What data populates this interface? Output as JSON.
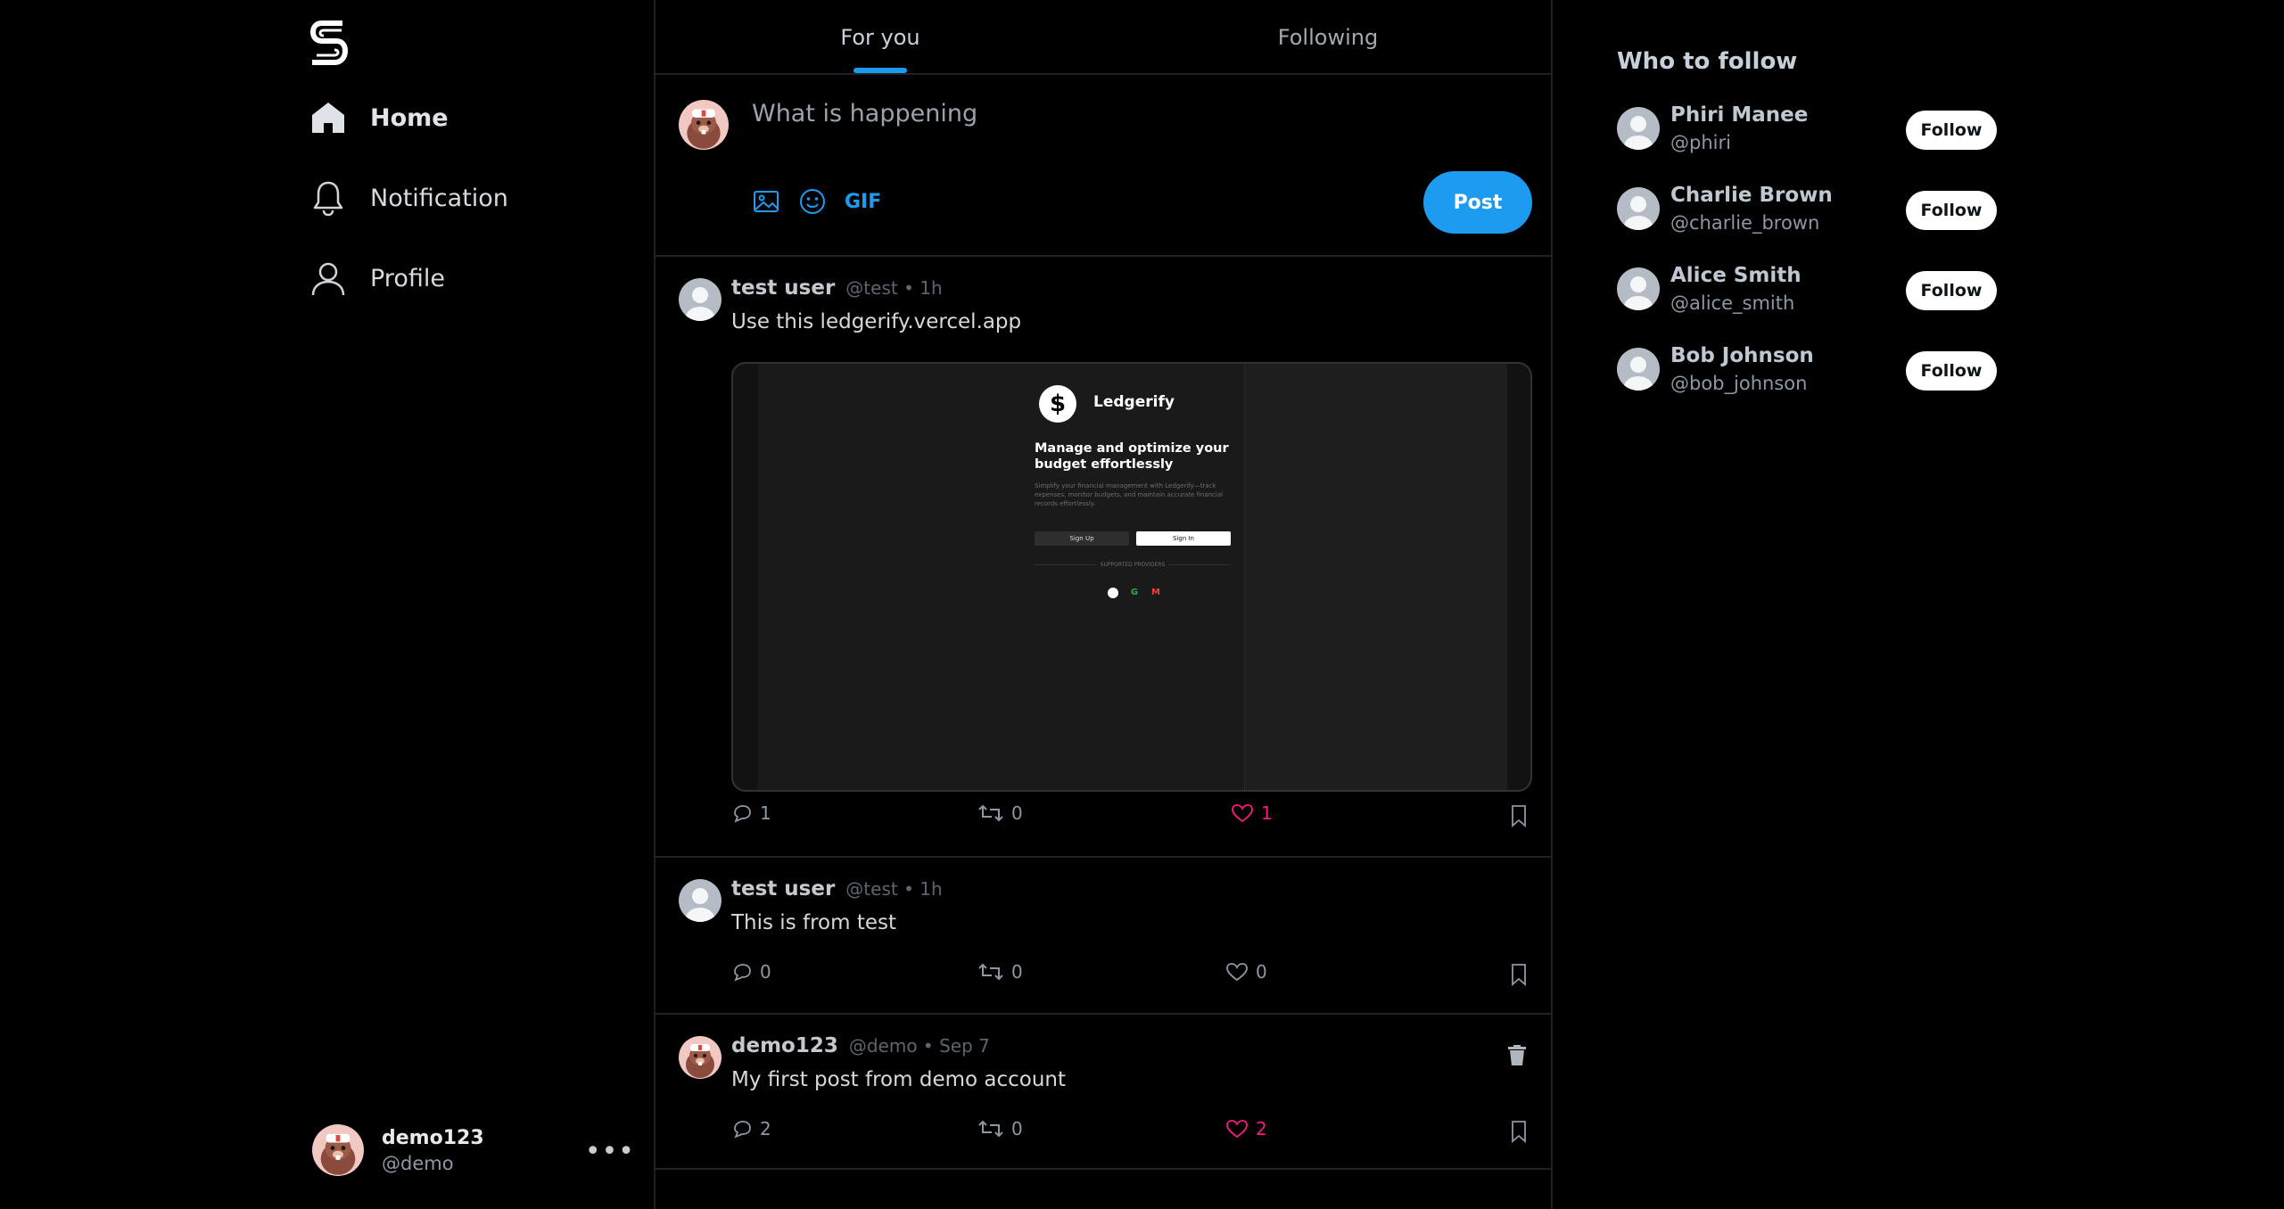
{
  "nav": {
    "items": [
      {
        "label": "Home",
        "icon": "home-icon"
      },
      {
        "label": "Notification",
        "icon": "bell-icon"
      },
      {
        "label": "Profile",
        "icon": "user-icon"
      }
    ]
  },
  "account": {
    "name": "demo123",
    "handle": "@demo",
    "more": "•••"
  },
  "tabs": [
    {
      "label": "For you"
    },
    {
      "label": "Following"
    }
  ],
  "composer": {
    "placeholder": "What is happening",
    "gif_label": "GIF",
    "post_label": "Post"
  },
  "posts": [
    {
      "user": "test user",
      "meta": "@test • 1h",
      "text": "Use this ledgerify.vercel.app",
      "replies": "1",
      "reposts": "0",
      "likes": "1",
      "liked": true,
      "preview": {
        "brand": "Ledgerify",
        "brand_glyph": "$",
        "headline": "Manage and optimize your budget effortlessly",
        "subtitle": "Simplify your financial management with Ledgerify—track expenses, monitor budgets, and maintain accurate financial records effortlessly.",
        "signup": "Sign Up",
        "signin": "Sign In",
        "providers_label": "SUPPORTED PROVIDERS"
      }
    },
    {
      "user": "test user",
      "meta": "@test • 1h",
      "text": "This is from test",
      "replies": "0",
      "reposts": "0",
      "likes": "0",
      "liked": false
    },
    {
      "user": "demo123",
      "meta": "@demo • Sep 7",
      "text": "My first post from demo account",
      "replies": "2",
      "reposts": "0",
      "likes": "2",
      "liked": true
    }
  ],
  "who_to_follow": {
    "title": "Who to follow",
    "button_label": "Follow",
    "users": [
      {
        "name": "Phiri Manee",
        "handle": "@phiri"
      },
      {
        "name": "Charlie Brown",
        "handle": "@charlie_brown"
      },
      {
        "name": "Alice Smith",
        "handle": "@alice_smith"
      },
      {
        "name": "Bob Johnson",
        "handle": "@bob_johnson"
      }
    ]
  },
  "colors": {
    "accent": "#1d9bf0",
    "like": "#f91880",
    "background": "#000000"
  }
}
